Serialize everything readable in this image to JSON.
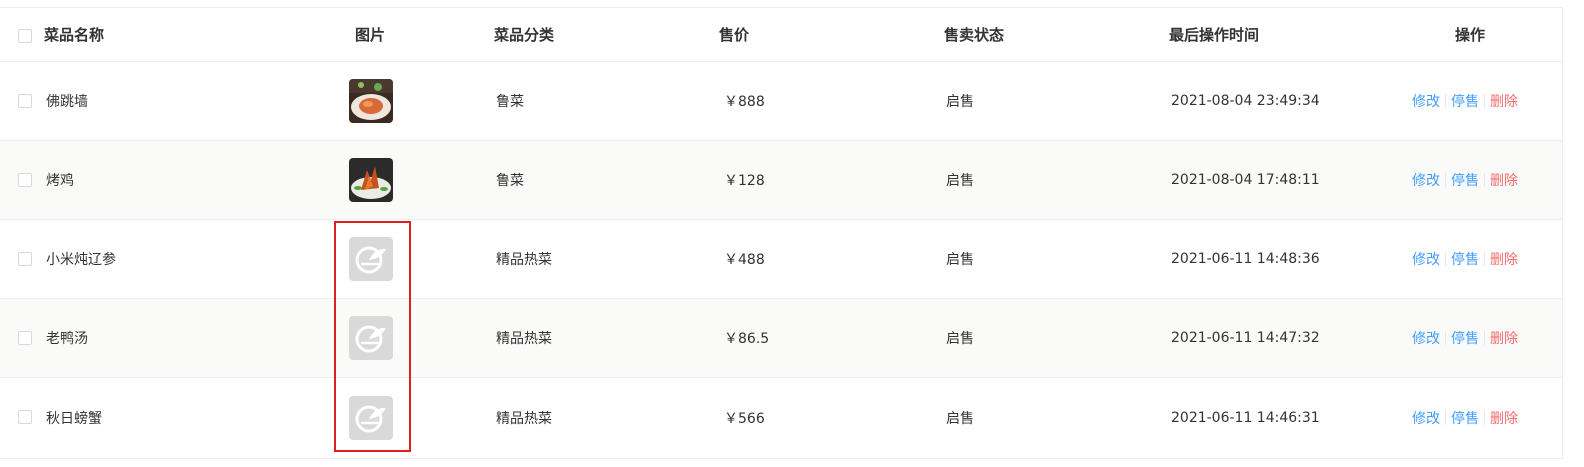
{
  "header": {
    "name": "菜品名称",
    "image": "图片",
    "category": "菜品分类",
    "price": "售价",
    "status": "售卖状态",
    "updated": "最后操作时间",
    "actions": "操作"
  },
  "rows": [
    {
      "name": "佛跳墙",
      "image": "food-photo-fotiaoqiang",
      "category": "鲁菜",
      "price": "￥888",
      "status": "启售",
      "updated": "2021-08-04 23:49:34",
      "edit": "修改",
      "stop": "停售",
      "delete": "删除"
    },
    {
      "name": "烤鸡",
      "image": "food-photo-roast-chicken",
      "category": "鲁菜",
      "price": "￥128",
      "status": "启售",
      "updated": "2021-08-04 17:48:11",
      "edit": "修改",
      "stop": "停售",
      "delete": "删除"
    },
    {
      "name": "小米炖辽参",
      "image": "placeholder-logo",
      "category": "精品热菜",
      "price": "￥488",
      "status": "启售",
      "updated": "2021-06-11 14:48:36",
      "edit": "修改",
      "stop": "停售",
      "delete": "删除"
    },
    {
      "name": "老鸭汤",
      "image": "placeholder-logo",
      "category": "精品热菜",
      "price": "￥86.5",
      "status": "启售",
      "updated": "2021-06-11 14:47:32",
      "edit": "修改",
      "stop": "停售",
      "delete": "删除"
    },
    {
      "name": "秋日螃蟹",
      "image": "placeholder-logo",
      "category": "精品热菜",
      "price": "￥566",
      "status": "启售",
      "updated": "2021-06-11 14:46:31",
      "edit": "修改",
      "stop": "停售",
      "delete": "删除"
    }
  ],
  "colors": {
    "edit": "#419eff",
    "stop": "#419eff",
    "delete": "#f56c6c",
    "highlight": "#e02020",
    "stripe": "#fafaf9"
  }
}
